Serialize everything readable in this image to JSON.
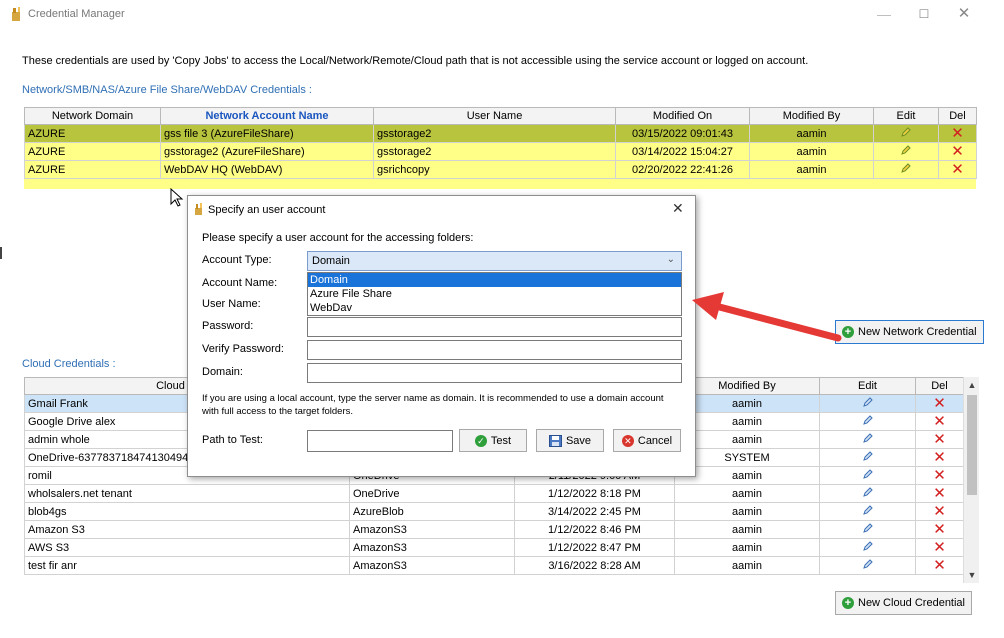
{
  "window": {
    "title": "Credential Manager",
    "minimize": "—",
    "maximize": "☐",
    "close": "✕"
  },
  "description": "These credentials are used by 'Copy Jobs' to access the Local/Network/Remote/Cloud path that is not accessible using the service account or logged on account.",
  "network": {
    "section_label": "Network/SMB/NAS/Azure File Share/WebDAV Credentials :",
    "headers": [
      "Network Domain",
      "Network Account Name",
      "User Name",
      "Modified On",
      "Modified By",
      "Edit",
      "Del"
    ],
    "rows": [
      {
        "domain": "AZURE",
        "account": "gss file 3 (AzureFileShare)",
        "user": "gsstorage2",
        "modified_on": "03/15/2022 09:01:43",
        "modified_by": "aamin"
      },
      {
        "domain": "AZURE",
        "account": "gsstorage2 (AzureFileShare)",
        "user": "gsstorage2",
        "modified_on": "03/14/2022 15:04:27",
        "modified_by": "aamin"
      },
      {
        "domain": "AZURE",
        "account": "WebDAV HQ (WebDAV)",
        "user": "gsrichcopy",
        "modified_on": "02/20/2022 22:41:26",
        "modified_by": "aamin"
      }
    ],
    "new_button": "New Network Credential"
  },
  "cloud": {
    "section_label": "Cloud Credentials :",
    "headers": [
      "Cloud Accou",
      "",
      "",
      "Modified By",
      "Edit",
      "Del"
    ],
    "rows": [
      {
        "name": "Gmail Frank",
        "type": "",
        "modified_on": "",
        "modified_by": "aamin"
      },
      {
        "name": "Google Drive alex",
        "type": "",
        "modified_on": "",
        "modified_by": "aamin"
      },
      {
        "name": "admin whole",
        "type": "",
        "modified_on": "",
        "modified_by": "aamin"
      },
      {
        "name": "OneDrive-637783718474130494",
        "type": "",
        "modified_on": "",
        "modified_by": "SYSTEM"
      },
      {
        "name": "romil",
        "type": "OneDrive",
        "modified_on": "2/11/2022 9:00 AM",
        "modified_by": "aamin"
      },
      {
        "name": "wholsalers.net tenant",
        "type": "OneDrive",
        "modified_on": "1/12/2022 8:18 PM",
        "modified_by": "aamin"
      },
      {
        "name": "blob4gs",
        "type": "AzureBlob",
        "modified_on": "3/14/2022 2:45 PM",
        "modified_by": "aamin"
      },
      {
        "name": "Amazon S3",
        "type": "AmazonS3",
        "modified_on": "1/12/2022 8:46 PM",
        "modified_by": "aamin"
      },
      {
        "name": "AWS S3",
        "type": "AmazonS3",
        "modified_on": "1/12/2022 8:47 PM",
        "modified_by": "aamin"
      },
      {
        "name": "test fir anr",
        "type": "AmazonS3",
        "modified_on": "3/16/2022 8:28 AM",
        "modified_by": "aamin"
      }
    ],
    "new_button": "New Cloud Credential"
  },
  "dialog": {
    "title": "Specify an user account",
    "close": "✕",
    "prompt": "Please specify a user account for the accessing folders:",
    "labels": {
      "account_type": "Account Type:",
      "account_name": "Account Name:",
      "user_name": "User Name:",
      "password": "Password:",
      "verify_password": "Verify Password:",
      "domain": "Domain:",
      "path_to_test": "Path to Test:"
    },
    "account_type_value": "Domain",
    "account_type_options": [
      "Domain",
      "Azure File Share",
      "WebDav"
    ],
    "note": "If you are using a local account, type the server name as domain. It is recommended to use a domain account with full access to the target folders.",
    "buttons": {
      "test": "Test",
      "save": "Save",
      "cancel": "Cancel"
    }
  },
  "colors": {
    "section_label": "#2f6fb5",
    "highlight_row": "#ffff88",
    "selected_row": "#b8c43d",
    "cloud_selected": "#cde3f7",
    "delete": "#d21f1f",
    "annotation_arrow": "#e53935"
  }
}
